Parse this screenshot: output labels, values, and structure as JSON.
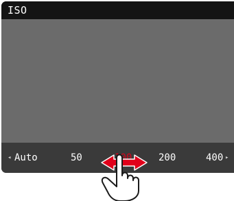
{
  "header": {
    "title": "ISO"
  },
  "iso_selector": {
    "left_arrow_icon": "chevron-left",
    "right_arrow_icon": "chevron-right",
    "options": [
      "Auto",
      "50",
      "100",
      "200",
      "400"
    ],
    "selected": "100",
    "selected_color": "#e1001a"
  },
  "gesture": {
    "hand_icon": "pointing-hand",
    "swipe_arrow_icon": "double-headed-arrow",
    "arrow_color": "#e1001a"
  }
}
